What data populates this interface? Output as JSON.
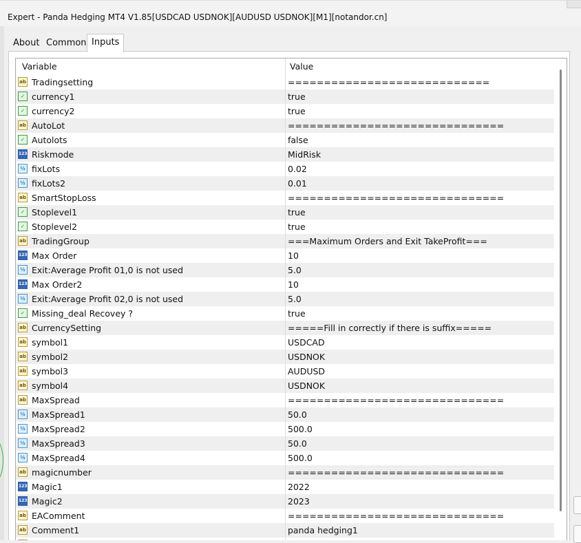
{
  "window": {
    "title": "Expert - Panda Hedging MT4 V1.85[USDCAD USDNOK][AUDUSD USDNOK][M1][notandor.cn]"
  },
  "tabs": [
    {
      "label": "About"
    },
    {
      "label": "Common"
    },
    {
      "label": "Inputs",
      "active": true
    }
  ],
  "table": {
    "columns": [
      "Variable",
      "Value"
    ],
    "rows": [
      {
        "type": "ab",
        "icon": "string-type-icon",
        "name": "Tradingsetting",
        "value": "============================"
      },
      {
        "type": "b",
        "icon": "bool-type-icon",
        "name": "currency1",
        "value": "true"
      },
      {
        "type": "b",
        "icon": "bool-type-icon",
        "name": "currency2",
        "value": "true"
      },
      {
        "type": "ab",
        "icon": "string-type-icon",
        "name": "AutoLot",
        "value": "=============================="
      },
      {
        "type": "b",
        "icon": "bool-type-icon",
        "name": "Autolots",
        "value": "false"
      },
      {
        "type": "i",
        "icon": "int-type-icon",
        "name": "Riskmode",
        "value": "MidRisk"
      },
      {
        "type": "f",
        "icon": "double-type-icon",
        "name": "fixLots",
        "value": "0.02"
      },
      {
        "type": "f",
        "icon": "double-type-icon",
        "name": "fixLots2",
        "value": "0.01"
      },
      {
        "type": "ab",
        "icon": "string-type-icon",
        "name": "SmartStopLoss",
        "value": "=============================="
      },
      {
        "type": "b",
        "icon": "bool-type-icon",
        "name": "Stoplevel1",
        "value": "true"
      },
      {
        "type": "b",
        "icon": "bool-type-icon",
        "name": "Stoplevel2",
        "value": "true"
      },
      {
        "type": "ab",
        "icon": "string-type-icon",
        "name": "TradingGroup",
        "value": "===Maximum Orders and Exit TakeProfit==="
      },
      {
        "type": "i",
        "icon": "int-type-icon",
        "name": "Max Order",
        "value": "10"
      },
      {
        "type": "f",
        "icon": "double-type-icon",
        "name": "Exit:Average Profit 01,0 is not used",
        "value": "5.0"
      },
      {
        "type": "i",
        "icon": "int-type-icon",
        "name": "Max Order2",
        "value": "10"
      },
      {
        "type": "f",
        "icon": "double-type-icon",
        "name": "Exit:Average Profit 02,0 is not used",
        "value": "5.0"
      },
      {
        "type": "b",
        "icon": "bool-type-icon",
        "name": "Missing_deal Recovey ?",
        "value": "true"
      },
      {
        "type": "ab",
        "icon": "string-type-icon",
        "name": "CurrencySetting",
        "value": "=====Fill in correctly if there is suffix====="
      },
      {
        "type": "ab",
        "icon": "string-type-icon",
        "name": "symbol1",
        "value": "USDCAD"
      },
      {
        "type": "ab",
        "icon": "string-type-icon",
        "name": "symbol2",
        "value": "USDNOK"
      },
      {
        "type": "ab",
        "icon": "string-type-icon",
        "name": "symbol3",
        "value": "AUDUSD"
      },
      {
        "type": "ab",
        "icon": "string-type-icon",
        "name": "symbol4",
        "value": "USDNOK"
      },
      {
        "type": "ab",
        "icon": "string-type-icon",
        "name": "MaxSpread",
        "value": "=============================="
      },
      {
        "type": "f",
        "icon": "double-type-icon",
        "name": "MaxSpread1",
        "value": "50.0"
      },
      {
        "type": "f",
        "icon": "double-type-icon",
        "name": "MaxSpread2",
        "value": "500.0"
      },
      {
        "type": "f",
        "icon": "double-type-icon",
        "name": "MaxSpread3",
        "value": "50.0"
      },
      {
        "type": "f",
        "icon": "double-type-icon",
        "name": "MaxSpread4",
        "value": "500.0"
      },
      {
        "type": "ab",
        "icon": "string-type-icon",
        "name": "magicnumber",
        "value": "=============================="
      },
      {
        "type": "i",
        "icon": "int-type-icon",
        "name": "Magic1",
        "value": "2022"
      },
      {
        "type": "i",
        "icon": "int-type-icon",
        "name": "Magic2",
        "value": "2023"
      },
      {
        "type": "ab",
        "icon": "string-type-icon",
        "name": "EAComment",
        "value": "=============================="
      },
      {
        "type": "ab",
        "icon": "string-type-icon",
        "name": "Comment1",
        "value": "panda hedging1"
      },
      {
        "type": "ab",
        "icon": "string-type-icon",
        "name": "",
        "value": ""
      }
    ]
  }
}
